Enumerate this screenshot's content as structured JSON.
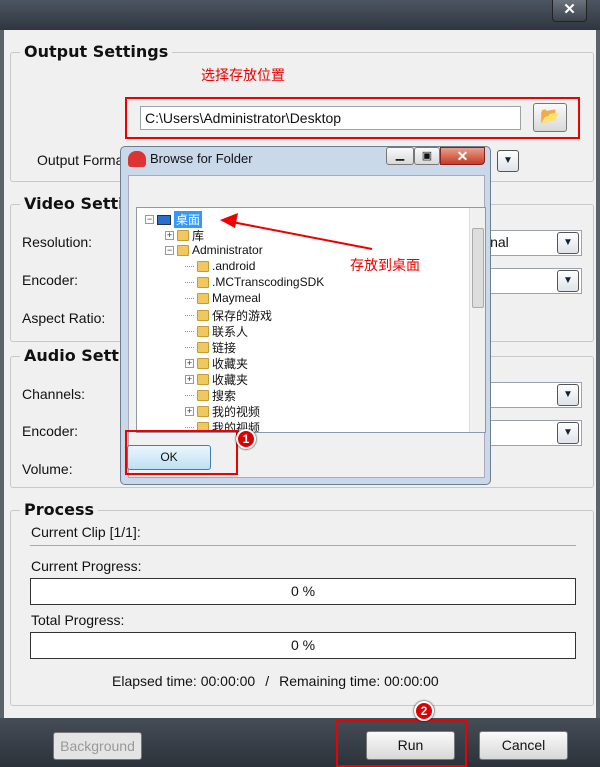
{
  "window": {
    "close": "✕"
  },
  "output": {
    "title": "Output Settings",
    "hint": "选择存放位置",
    "path": "C:\\Users\\Administrator\\Desktop",
    "format_label": "Output Forma"
  },
  "video": {
    "title": "Video Settin",
    "resolution": "Resolution:",
    "resolution_value": "inal",
    "encoder": "Encoder:",
    "aspect": "Aspect Ratio:"
  },
  "audio": {
    "title": "Audio Settin",
    "channels": "Channels:",
    "encoder": "Encoder:",
    "volume": "Volume:"
  },
  "process": {
    "title": "Process",
    "clip": "Current Clip [1/1]:",
    "current_label": "Current Progress:",
    "current_value": "0 %",
    "current_pct": 0,
    "total_label": "Total Progress:",
    "total_value": "0 %",
    "total_pct": 0,
    "elapsed": "Elapsed time: 00:00:00",
    "sep": "/",
    "remaining": "Remaining time: 00:00:00"
  },
  "buttons": {
    "background": "Background",
    "run": "Run",
    "cancel": "Cancel"
  },
  "dialog": {
    "title": "Browse for Folder",
    "ok": "OK",
    "annotation": "存放到桌面",
    "badge1": "1",
    "badge2": "2",
    "tree": [
      {
        "label": "桌面",
        "level": 0,
        "expander": "−",
        "selected": true
      },
      {
        "label": "库",
        "level": 1,
        "expander": "+"
      },
      {
        "label": "Administrator",
        "level": 1,
        "expander": "−"
      },
      {
        "label": ".android",
        "level": 2
      },
      {
        "label": ".MCTranscodingSDK",
        "level": 2
      },
      {
        "label": "Maymeal",
        "level": 2
      },
      {
        "label": "保存的游戏",
        "level": 2
      },
      {
        "label": "联系人",
        "level": 2
      },
      {
        "label": "链接",
        "level": 2
      },
      {
        "label": "收藏夹",
        "level": 2,
        "expander": "+"
      },
      {
        "label": "收藏夹",
        "level": 2,
        "expander": "+"
      },
      {
        "label": "搜索",
        "level": 2
      },
      {
        "label": "我的视频",
        "level": 2,
        "expander": "+"
      },
      {
        "label": "我的视频",
        "level": 2
      }
    ]
  },
  "colors": {
    "annotation": "#ee0000",
    "selection": "#3399ff"
  }
}
